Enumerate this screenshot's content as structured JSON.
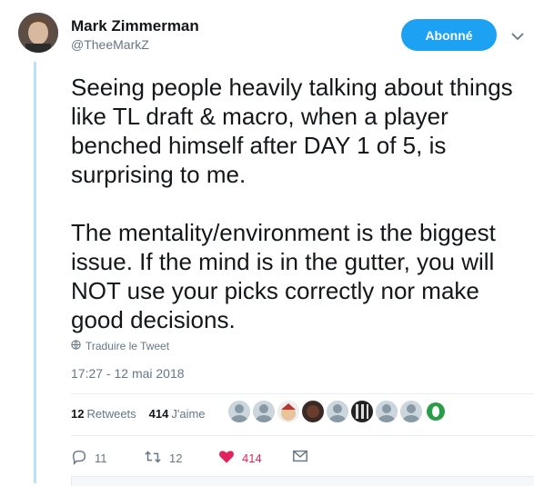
{
  "author": {
    "name": "Mark Zimmerman",
    "handle": "@TheeMarkZ"
  },
  "follow_button": {
    "label": "Abonné"
  },
  "tweet": {
    "text": "Seeing people heavily talking about things like TL draft & macro, when a player benched himself after DAY 1 of 5, is surprising to me.\n\nThe mentality/environment is the biggest issue. If the mind is in the gutter, you will NOT use your picks correctly nor make good decisions.",
    "translate_label": "Traduire le Tweet",
    "timestamp": "17:27 - 12 mai 2018"
  },
  "stats": {
    "retweets_count": "12",
    "retweets_label": "Retweets",
    "likes_count": "414",
    "likes_label": "J'aime"
  },
  "actions": {
    "reply_count": "11",
    "retweet_count": "12",
    "like_count": "414"
  },
  "colors": {
    "accent": "#1da1f2",
    "like": "#e0245e",
    "muted": "#657786",
    "thread": "#b8e1fb"
  }
}
